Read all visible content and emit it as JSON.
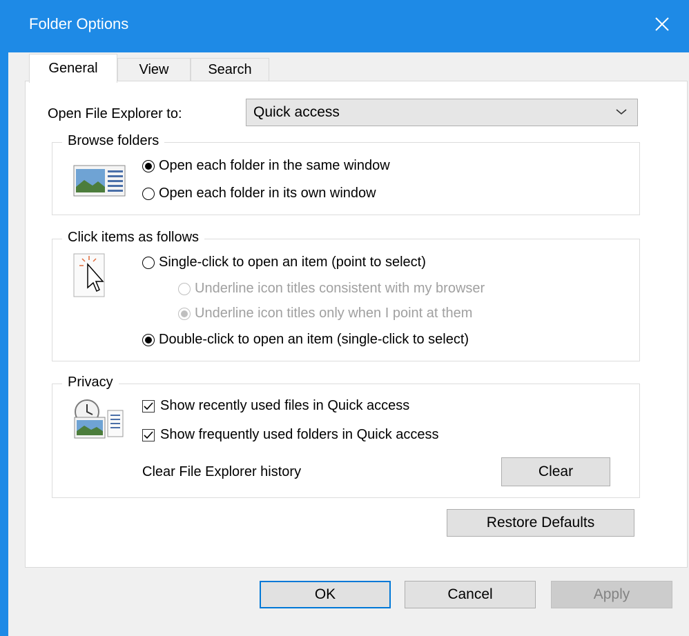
{
  "window": {
    "title": "Folder Options"
  },
  "tabs": [
    {
      "label": "General",
      "active": true
    },
    {
      "label": "View",
      "active": false
    },
    {
      "label": "Search",
      "active": false
    }
  ],
  "open_to": {
    "label": "Open File Explorer to:",
    "value": "Quick access"
  },
  "browse_folders": {
    "legend": "Browse folders",
    "options": [
      {
        "label": "Open each folder in the same window",
        "checked": true
      },
      {
        "label": "Open each folder in its own window",
        "checked": false
      }
    ]
  },
  "click_items": {
    "legend": "Click items as follows",
    "single_click": {
      "label": "Single-click to open an item (point to select)",
      "checked": false
    },
    "underline_browser": {
      "label": "Underline icon titles consistent with my browser",
      "checked": false,
      "disabled": true
    },
    "underline_point": {
      "label": "Underline icon titles only when I point at them",
      "checked": true,
      "disabled": true
    },
    "double_click": {
      "label": "Double-click to open an item (single-click to select)",
      "checked": true
    }
  },
  "privacy": {
    "legend": "Privacy",
    "recent_files": {
      "label": "Show recently used files in Quick access",
      "checked": true
    },
    "frequent_folders": {
      "label": "Show frequently used folders in Quick access",
      "checked": true
    },
    "clear_label": "Clear File Explorer history",
    "clear_button": "Clear"
  },
  "restore_defaults": "Restore Defaults",
  "footer": {
    "ok": "OK",
    "cancel": "Cancel",
    "apply": "Apply"
  },
  "colors": {
    "titlebar": "#1e8ae6",
    "accent": "#0078d7"
  }
}
